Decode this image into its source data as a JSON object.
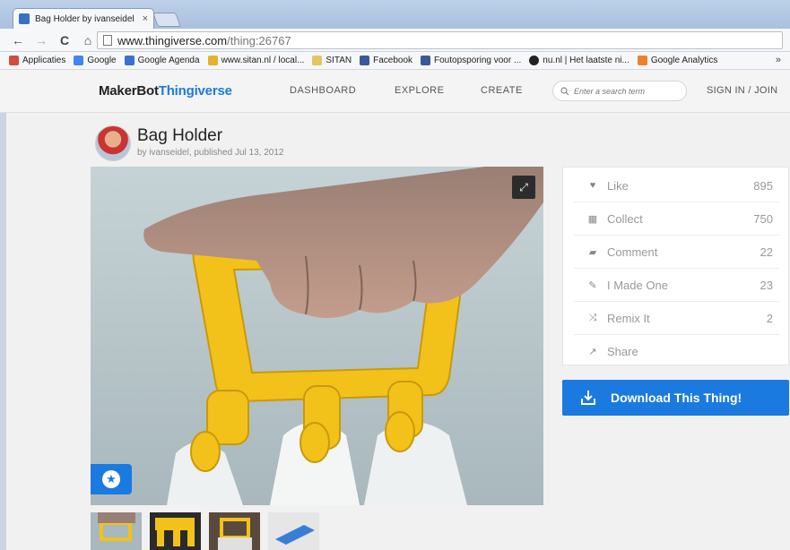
{
  "browser": {
    "tab_title": "Bag Holder by ivanseidel",
    "tab_close": "×",
    "url_domain": "www.thingiverse.com",
    "url_path": "/thing:26767",
    "nav": {
      "back": "←",
      "forward": "→",
      "reload": "C",
      "home": "⌂"
    },
    "bookmarks": [
      {
        "label": "Applicaties",
        "color": "#d64b3c"
      },
      {
        "label": "Google",
        "color": "#4285f4"
      },
      {
        "label": "Google Agenda",
        "color": "#3b6fd4"
      },
      {
        "label": "www.sitan.nl / local...",
        "color": "#e6b12c"
      },
      {
        "label": "SITAN",
        "color": "#e3c563"
      },
      {
        "label": "Facebook",
        "color": "#3b5998"
      },
      {
        "label": "Foutopsporing voor ...",
        "color": "#3b5998"
      },
      {
        "label": "nu.nl | Het laatste ni...",
        "color": "#222222"
      },
      {
        "label": "Google Analytics",
        "color": "#f0802a"
      }
    ],
    "bookmarks_more": "»"
  },
  "site": {
    "logo_maker": "MakerBot",
    "logo_thingiverse": "Thingiverse",
    "nav": [
      "DASHBOARD",
      "EXPLORE",
      "CREATE"
    ],
    "search_placeholder": "Enter a search term",
    "signin": "SIGN IN / JOIN",
    "brand_color": "#1b7ae0"
  },
  "thing": {
    "title": "Bag Holder",
    "meta": "by ivanseidel, published Jul 13, 2012"
  },
  "actions": [
    {
      "icon": "heart-icon",
      "glyph": "♥",
      "label": "Like",
      "count": "895"
    },
    {
      "icon": "collect-icon",
      "glyph": "▦",
      "label": "Collect",
      "count": "750"
    },
    {
      "icon": "comment-icon",
      "glyph": "▰",
      "label": "Comment",
      "count": "22"
    },
    {
      "icon": "made-one-icon",
      "glyph": "✎",
      "label": "I Made One",
      "count": "23"
    },
    {
      "icon": "remix-icon",
      "glyph": "⤨",
      "label": "Remix It",
      "count": "2"
    },
    {
      "icon": "share-icon",
      "glyph": "↗",
      "label": "Share",
      "count": ""
    }
  ],
  "download": {
    "label": "Download This Thing!"
  }
}
